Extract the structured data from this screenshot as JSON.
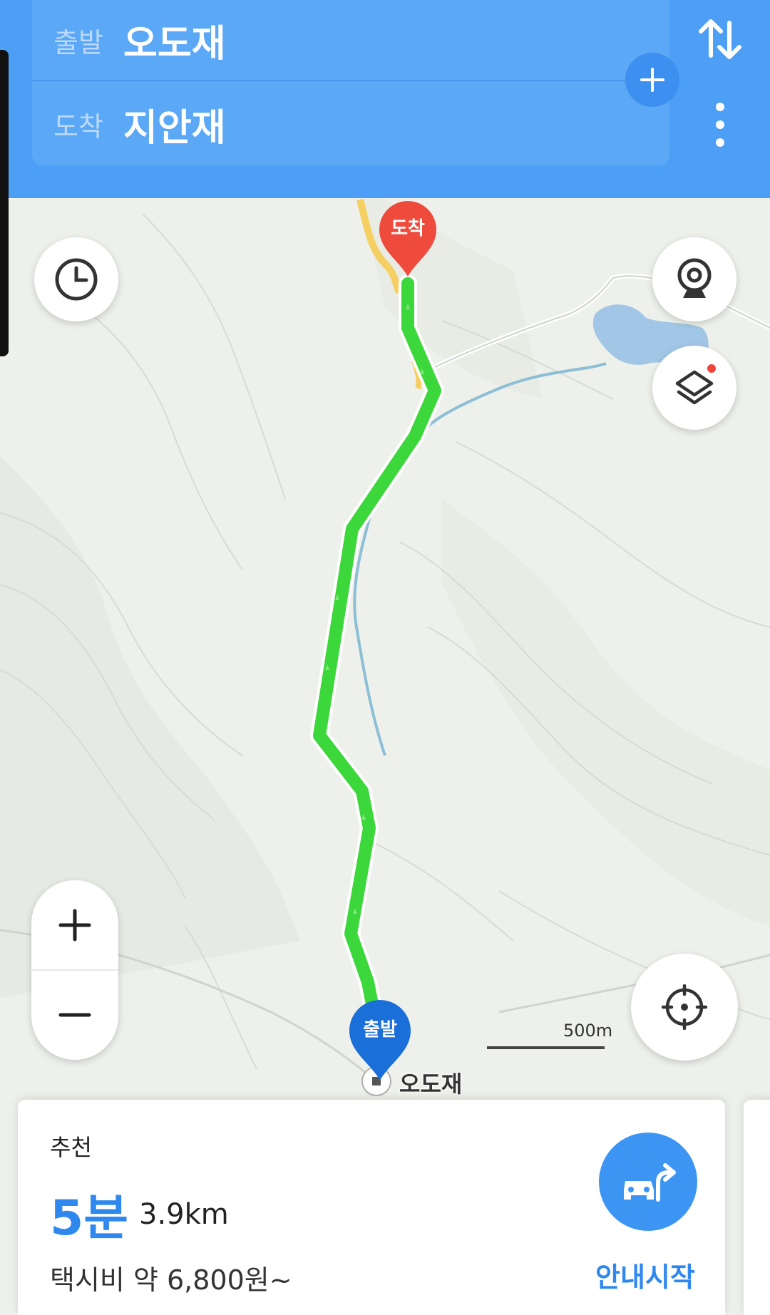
{
  "header": {
    "origin_label": "출발",
    "origin_value": "오도재",
    "destination_label": "도착",
    "destination_value": "지안재"
  },
  "map": {
    "destination_pin": "도착",
    "origin_pin": "출발",
    "place_label": "오도재",
    "scale_label": "500m",
    "route_color": "#3cd73a",
    "origin_pin_color": "#1b6fd9",
    "destination_pin_color": "#ef4b3c"
  },
  "controls": {
    "history_icon": "clock-icon",
    "cctv_icon": "cctv-icon",
    "layers_icon": "layers-icon",
    "locate_icon": "crosshair-icon",
    "zoom_in_icon": "plus-icon",
    "zoom_out_icon": "minus-icon",
    "swap_icon": "swap-arrows-icon",
    "more_icon": "more-vertical-icon",
    "add_waypoint_icon": "plus-icon"
  },
  "route_card": {
    "tag": "추천",
    "time": "5분",
    "distance": "3.9km",
    "fare": "택시비 약 6,800원~",
    "start_label": "안내시작",
    "accent": "#2f88ee"
  }
}
